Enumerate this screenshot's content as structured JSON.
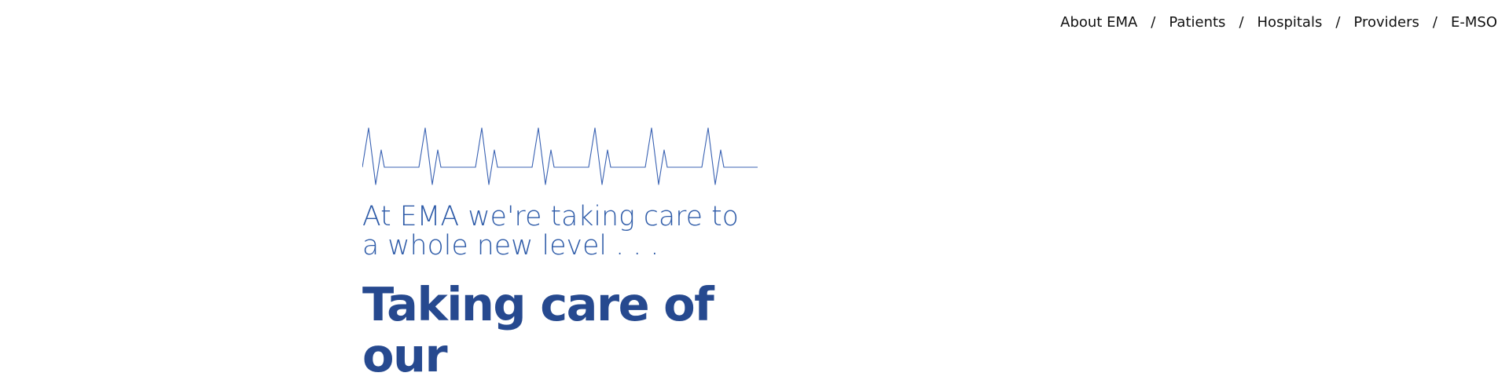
{
  "nav": {
    "items": [
      {
        "label": "About EMA"
      },
      {
        "label": "Patients"
      },
      {
        "label": "Hospitals"
      },
      {
        "label": "Providers"
      },
      {
        "label": "E-MSO"
      }
    ],
    "separator": "/"
  },
  "hero": {
    "tagline": "At EMA we're taking care to a whole new level . . .",
    "headline": "Taking care of our"
  },
  "colors": {
    "accent": "#2e5ba8",
    "headline": "#26498f",
    "pulse_line": "#3b63b3"
  },
  "icons": {
    "pulse": "heartbeat-line-icon"
  }
}
